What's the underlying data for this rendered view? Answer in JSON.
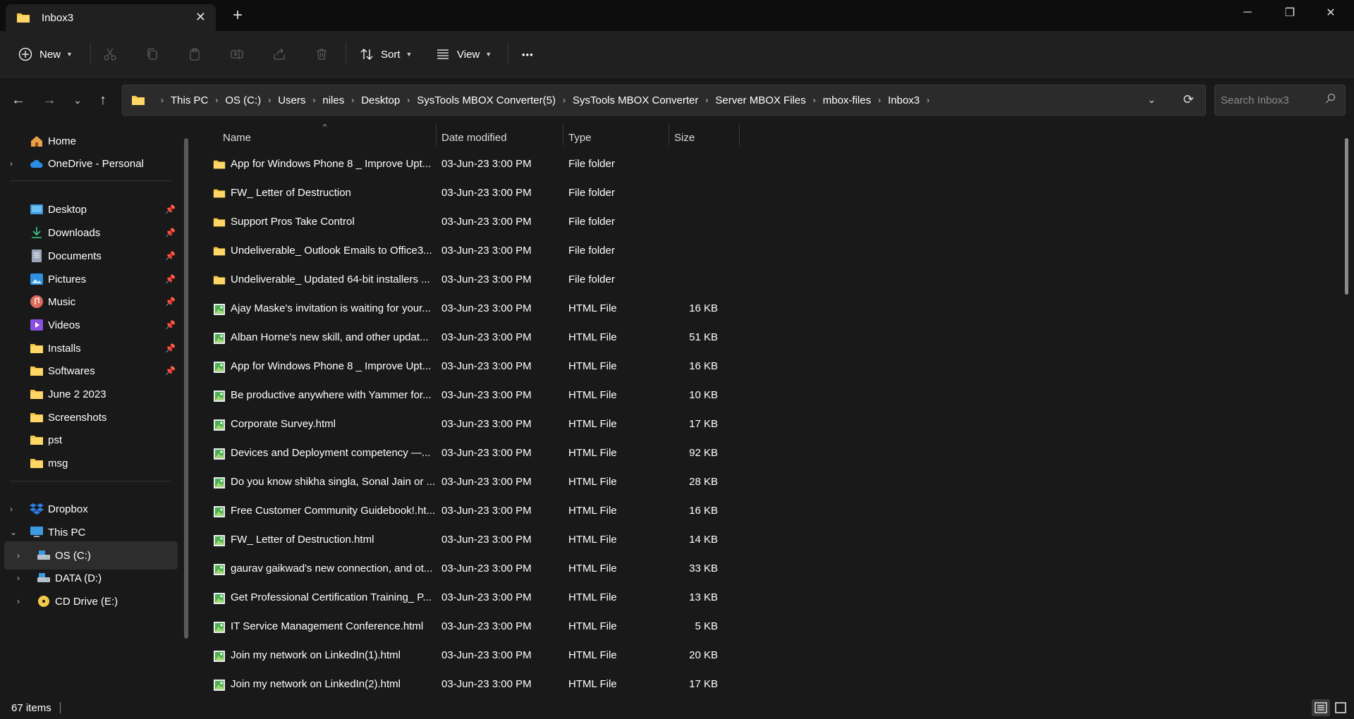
{
  "window": {
    "tab_title": "Inbox3",
    "tab_close_symbol": "✕",
    "new_tab_symbol": "+",
    "minimize_symbol": "─",
    "maximize_symbol": "❐",
    "close_symbol": "✕"
  },
  "toolbar": {
    "new_label": "New",
    "sort_label": "Sort",
    "view_label": "View",
    "more_symbol": "•••",
    "icons": [
      "cut-icon",
      "copy-icon",
      "paste-icon",
      "rename-icon",
      "share-icon",
      "delete-icon"
    ]
  },
  "address": {
    "breadcrumbs": [
      "This PC",
      "OS (C:)",
      "Users",
      "niles",
      "Desktop",
      "SysTools MBOX Converter(5)",
      "SysTools MBOX Converter",
      "Server MBOX Files",
      "mbox-files",
      "Inbox3"
    ],
    "search_placeholder": "Search Inbox3"
  },
  "sidebar": {
    "items": [
      {
        "label": "Home",
        "icon": "home-icon"
      },
      {
        "label": "OneDrive - Personal",
        "icon": "cloud-icon"
      },
      {
        "label": "Desktop",
        "icon": "desktop-icon",
        "pinned": true
      },
      {
        "label": "Downloads",
        "icon": "download-icon",
        "pinned": true
      },
      {
        "label": "Documents",
        "icon": "document-icon",
        "pinned": true
      },
      {
        "label": "Pictures",
        "icon": "picture-icon",
        "pinned": true
      },
      {
        "label": "Music",
        "icon": "music-icon",
        "pinned": true
      },
      {
        "label": "Videos",
        "icon": "video-icon",
        "pinned": true
      },
      {
        "label": "Installs",
        "icon": "folder-icon",
        "pinned": true
      },
      {
        "label": "Softwares",
        "icon": "folder-icon",
        "pinned": true
      },
      {
        "label": "June 2 2023",
        "icon": "folder-icon"
      },
      {
        "label": "Screenshots",
        "icon": "folder-icon"
      },
      {
        "label": "pst",
        "icon": "folder-icon"
      },
      {
        "label": "msg",
        "icon": "folder-icon"
      },
      {
        "label": "Dropbox",
        "icon": "dropbox-icon"
      },
      {
        "label": "This PC",
        "icon": "computer-icon"
      },
      {
        "label": "OS (C:)",
        "icon": "drive-icon"
      },
      {
        "label": "DATA (D:)",
        "icon": "drive-icon"
      },
      {
        "label": "CD Drive (E:)",
        "icon": "cd-drive-icon"
      }
    ]
  },
  "columns": {
    "name": "Name",
    "date": "Date modified",
    "type": "Type",
    "size": "Size"
  },
  "files": [
    {
      "name": "App for Windows Phone 8 _ Improve Upt...",
      "date": "03-Jun-23 3:00 PM",
      "type": "File folder",
      "size": "",
      "kind": "folder"
    },
    {
      "name": "FW_ Letter of Destruction",
      "date": "03-Jun-23 3:00 PM",
      "type": "File folder",
      "size": "",
      "kind": "folder"
    },
    {
      "name": "Support Pros Take Control",
      "date": "03-Jun-23 3:00 PM",
      "type": "File folder",
      "size": "",
      "kind": "folder"
    },
    {
      "name": "Undeliverable_ Outlook Emails to Office3...",
      "date": "03-Jun-23 3:00 PM",
      "type": "File folder",
      "size": "",
      "kind": "folder"
    },
    {
      "name": "Undeliverable_ Updated 64-bit installers ...",
      "date": "03-Jun-23 3:00 PM",
      "type": "File folder",
      "size": "",
      "kind": "folder"
    },
    {
      "name": "Ajay Maske's invitation is waiting for your...",
      "date": "03-Jun-23 3:00 PM",
      "type": "HTML File",
      "size": "16 KB",
      "kind": "html"
    },
    {
      "name": "Alban Horne's new skill, and other updat...",
      "date": "03-Jun-23 3:00 PM",
      "type": "HTML File",
      "size": "51 KB",
      "kind": "html"
    },
    {
      "name": "App for Windows Phone 8 _ Improve Upt...",
      "date": "03-Jun-23 3:00 PM",
      "type": "HTML File",
      "size": "16 KB",
      "kind": "html"
    },
    {
      "name": "Be productive anywhere with Yammer for...",
      "date": "03-Jun-23 3:00 PM",
      "type": "HTML File",
      "size": "10 KB",
      "kind": "html"
    },
    {
      "name": "Corporate Survey.html",
      "date": "03-Jun-23 3:00 PM",
      "type": "HTML File",
      "size": "17 KB",
      "kind": "html"
    },
    {
      "name": "Devices and Deployment competency —...",
      "date": "03-Jun-23 3:00 PM",
      "type": "HTML File",
      "size": "92 KB",
      "kind": "html"
    },
    {
      "name": "Do you know shikha singla, Sonal Jain or ...",
      "date": "03-Jun-23 3:00 PM",
      "type": "HTML File",
      "size": "28 KB",
      "kind": "html"
    },
    {
      "name": "Free Customer Community Guidebook!.ht...",
      "date": "03-Jun-23 3:00 PM",
      "type": "HTML File",
      "size": "16 KB",
      "kind": "html"
    },
    {
      "name": "FW_ Letter of Destruction.html",
      "date": "03-Jun-23 3:00 PM",
      "type": "HTML File",
      "size": "14 KB",
      "kind": "html"
    },
    {
      "name": "gaurav gaikwad's new connection, and ot...",
      "date": "03-Jun-23 3:00 PM",
      "type": "HTML File",
      "size": "33 KB",
      "kind": "html"
    },
    {
      "name": "Get Professional Certification Training_ P...",
      "date": "03-Jun-23 3:00 PM",
      "type": "HTML File",
      "size": "13 KB",
      "kind": "html"
    },
    {
      "name": "IT Service Management Conference.html",
      "date": "03-Jun-23 3:00 PM",
      "type": "HTML File",
      "size": "5 KB",
      "kind": "html"
    },
    {
      "name": "Join my network on LinkedIn(1).html",
      "date": "03-Jun-23 3:00 PM",
      "type": "HTML File",
      "size": "20 KB",
      "kind": "html"
    },
    {
      "name": "Join my network on LinkedIn(2).html",
      "date": "03-Jun-23 3:00 PM",
      "type": "HTML File",
      "size": "17 KB",
      "kind": "html"
    }
  ],
  "status": {
    "item_count": "67 items"
  },
  "colors": {
    "folder": "#f6c343",
    "accent": "#4aa3ff"
  }
}
